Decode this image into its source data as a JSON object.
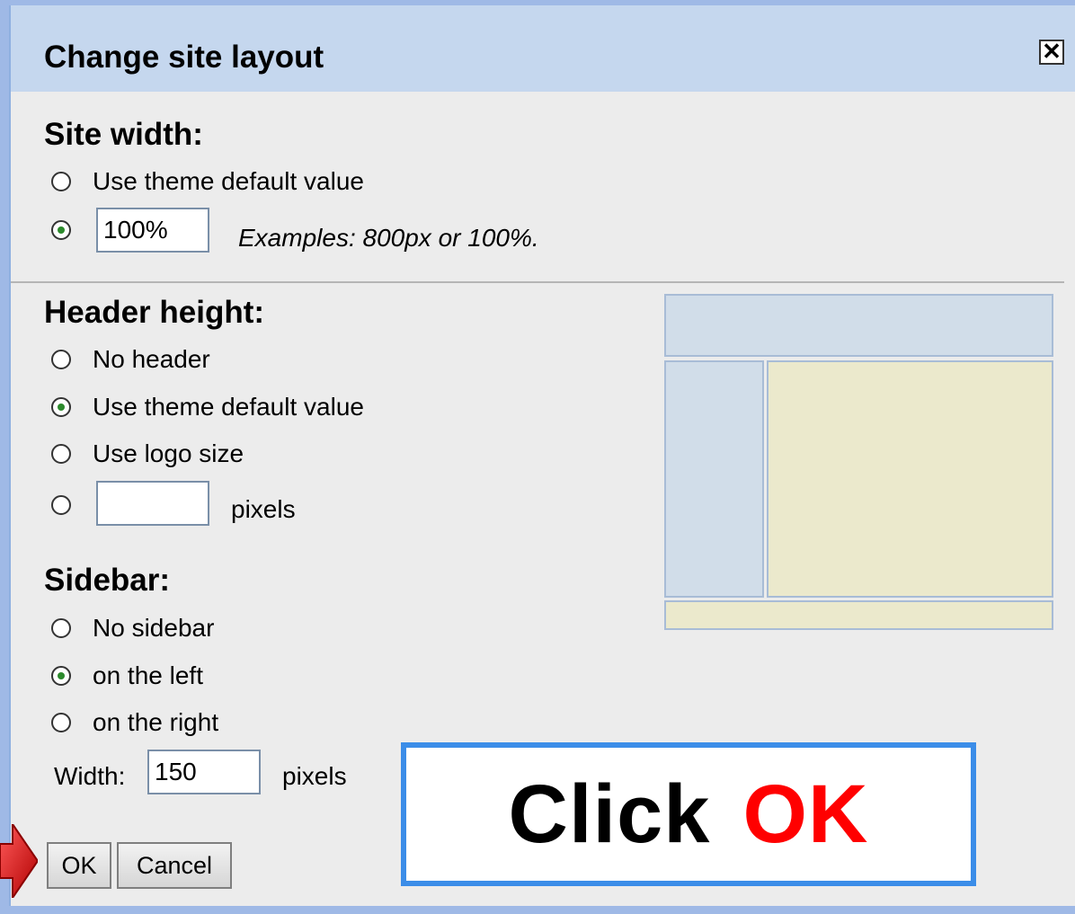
{
  "dialog": {
    "title": "Change site layout",
    "close_symbol": "✕"
  },
  "site_width": {
    "heading": "Site width:",
    "options": [
      {
        "label": "Use theme default value",
        "selected": false
      },
      {
        "label": "",
        "selected": true
      }
    ],
    "value": "100%",
    "example": "Examples: 800px or 100%."
  },
  "header_height": {
    "heading": "Header height:",
    "options": [
      {
        "label": "No header",
        "selected": false
      },
      {
        "label": "Use theme default value",
        "selected": true
      },
      {
        "label": "Use logo size",
        "selected": false
      },
      {
        "label": "",
        "selected": false
      }
    ],
    "value": "",
    "unit": "pixels"
  },
  "sidebar": {
    "heading": "Sidebar:",
    "options": [
      {
        "label": "No sidebar",
        "selected": false
      },
      {
        "label": "on the left",
        "selected": true
      },
      {
        "label": "on the right",
        "selected": false
      }
    ],
    "width_label": "Width:",
    "width_value": "150",
    "unit": "pixels"
  },
  "buttons": {
    "ok": "OK",
    "cancel": "Cancel"
  },
  "callout": {
    "text": "Click",
    "emphasis": "OK",
    "emphasis_color": "#ff0000",
    "border_color": "#3b8de8"
  },
  "colors": {
    "titlebar": "#c5d7ee",
    "preview_blue": "#d1dde9",
    "preview_cream": "#ebe9cc"
  }
}
